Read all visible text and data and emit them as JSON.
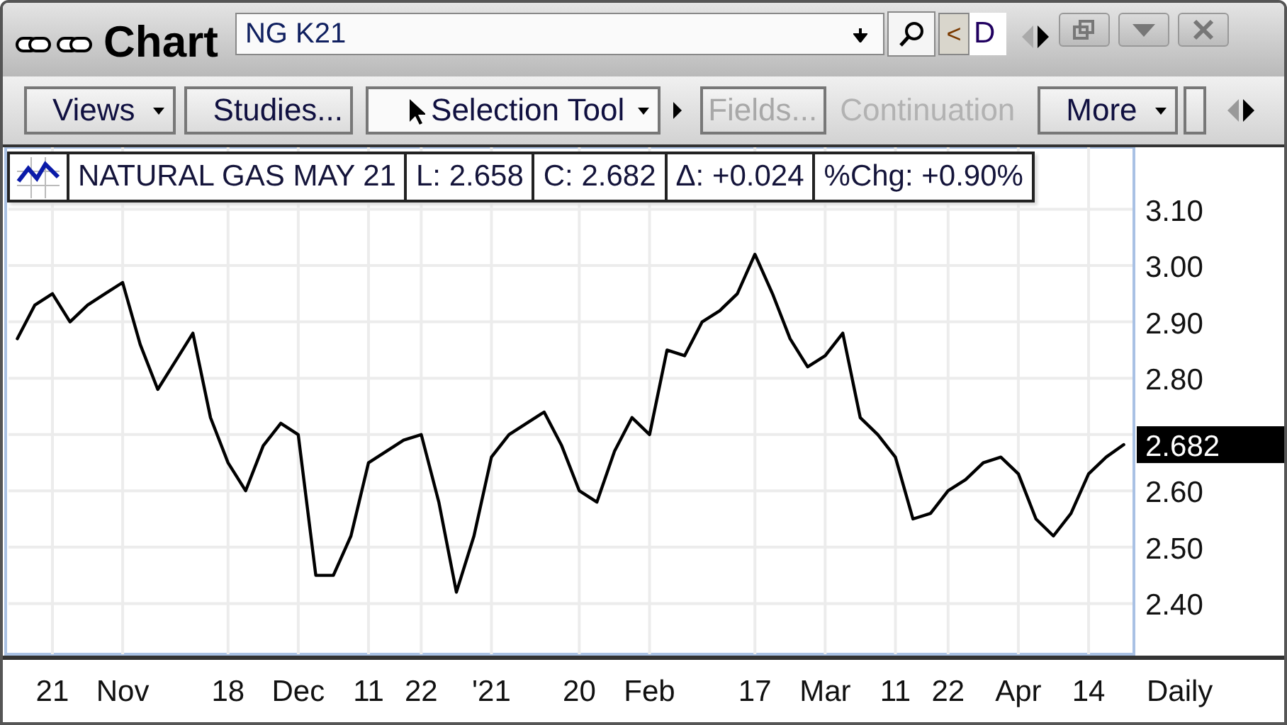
{
  "window": {
    "title": "Chart"
  },
  "symbol_field": {
    "value": "NG K21"
  },
  "history_button": {
    "label": "<"
  },
  "period_field": {
    "value": "D"
  },
  "toolbar": [
    {
      "label": "Views",
      "kind": "dropdown",
      "disabled": false
    },
    {
      "label": "Studies...",
      "kind": "button",
      "disabled": false
    },
    {
      "label": "Selection Tool",
      "kind": "tool",
      "disabled": false
    },
    {
      "label": "Fields...",
      "kind": "button",
      "disabled": true
    },
    {
      "label": "Continuation",
      "kind": "text",
      "disabled": true
    },
    {
      "label": "More",
      "kind": "dropdown",
      "disabled": false
    }
  ],
  "legend": [
    "L: 2.658",
    "C: 2.682",
    "Δ: +0.024",
    "%Chg: +0.90%"
  ],
  "chart": {
    "last_price": "2.682",
    "period": "Daily",
    "chart_data": {
      "type": "line",
      "grid": true,
      "ylim": [
        2.31,
        3.21
      ],
      "categories": [
        null,
        null,
        "21",
        null,
        null,
        null,
        "Nov",
        null,
        null,
        null,
        null,
        null,
        "18",
        null,
        null,
        null,
        "Dec",
        null,
        null,
        null,
        "11",
        null,
        null,
        "22",
        null,
        null,
        null,
        "'21",
        null,
        null,
        null,
        null,
        "20",
        null,
        null,
        null,
        "Feb",
        null,
        null,
        null,
        null,
        null,
        "17",
        null,
        null,
        null,
        "Mar",
        null,
        null,
        null,
        "11",
        null,
        null,
        "22",
        null,
        null,
        null,
        "Apr",
        null,
        null,
        null,
        "14",
        null,
        null
      ],
      "yticks": [
        {
          "value": 3.1,
          "label": "3.10"
        },
        {
          "value": 3.0,
          "label": "3.00"
        },
        {
          "value": 2.9,
          "label": "2.90"
        },
        {
          "value": 2.8,
          "label": "2.80"
        },
        {
          "value": 2.6,
          "label": "2.60"
        },
        {
          "value": 2.5,
          "label": "2.50"
        },
        {
          "value": 2.4,
          "label": "2.40"
        }
      ],
      "series": [
        {
          "name": "NATURAL GAS MAY 21",
          "color": "#000000",
          "values": [
            2.87,
            2.93,
            2.95,
            2.9,
            2.93,
            2.95,
            2.97,
            2.86,
            2.78,
            2.83,
            2.88,
            2.73,
            2.65,
            2.6,
            2.68,
            2.72,
            2.7,
            2.45,
            2.45,
            2.52,
            2.65,
            2.67,
            2.69,
            2.7,
            2.58,
            2.42,
            2.52,
            2.66,
            2.7,
            2.72,
            2.74,
            2.68,
            2.6,
            2.58,
            2.67,
            2.73,
            2.7,
            2.85,
            2.84,
            2.9,
            2.92,
            2.95,
            3.02,
            2.95,
            2.87,
            2.82,
            2.84,
            2.88,
            2.73,
            2.7,
            2.66,
            2.55,
            2.56,
            2.6,
            2.62,
            2.65,
            2.66,
            2.63,
            2.55,
            2.52,
            2.56,
            2.63,
            2.66,
            2.682
          ]
        }
      ]
    }
  }
}
